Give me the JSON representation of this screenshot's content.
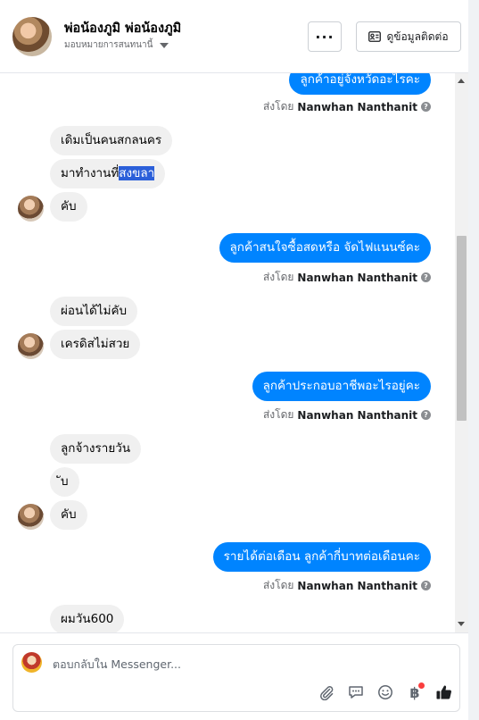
{
  "header": {
    "contact_name": "พ่อน้องภูมิ พ่อน้องภูมิ",
    "assignment_label": "มอบหมายการสนทนานี้",
    "more_label": "···",
    "contact_info_label": "ดูข้อมูลติดต่อ"
  },
  "messages": [
    {
      "id": "m1",
      "dir": "out",
      "text": "ลูกค้าอยู่จังหวัดอะไรคะ"
    },
    {
      "id": "m2",
      "dir": "in",
      "text": "เดิมเป็นคนสกลนคร"
    },
    {
      "id": "m3",
      "dir": "in",
      "text_before": "มาทำงานที่",
      "text_selected": "สงขลา"
    },
    {
      "id": "m4",
      "dir": "in",
      "text": "คับ"
    },
    {
      "id": "m5",
      "dir": "out",
      "text": "ลูกค้าสนใจซื้อสดหรือ จัดไฟแนนซ์คะ"
    },
    {
      "id": "m6",
      "dir": "in",
      "text": "ผ่อนได้ไม่คับ"
    },
    {
      "id": "m7",
      "dir": "in",
      "text": "เครดิสไม่สวย"
    },
    {
      "id": "m8",
      "dir": "out",
      "text": "ลูกค้าประกอบอาชีพอะไรอยู่คะ"
    },
    {
      "id": "m9",
      "dir": "in",
      "text": "ลูกจ้างรายวัน"
    },
    {
      "id": "m10",
      "dir": "in",
      "text": "ับ"
    },
    {
      "id": "m11",
      "dir": "in",
      "text": "คับ"
    },
    {
      "id": "m12",
      "dir": "out",
      "text": "รายได้ต่อเดือน ลูกค้ากี่บาทต่อเดือนคะ"
    },
    {
      "id": "m13",
      "dir": "in",
      "text": "ผมวัน600"
    }
  ],
  "sent_by": {
    "prefix": "ส่งโดย",
    "agent": "Nanwhan Nanthanit",
    "help_icon_label": "?"
  },
  "composer": {
    "placeholder": "ตอบกลับใน Messenger...",
    "baht_symbol": "฿"
  },
  "icons": {
    "attach": "paperclip-icon",
    "saved_replies": "chat-bubble-icon",
    "emoji": "smiley-icon",
    "payment": "baht-icon",
    "like": "thumbs-up-icon"
  },
  "colors": {
    "outgoing_bubble": "#0084ff",
    "incoming_bubble": "#f0f0f0",
    "selection": "#2b5fd9",
    "notification_dot": "#fa3e3e"
  }
}
